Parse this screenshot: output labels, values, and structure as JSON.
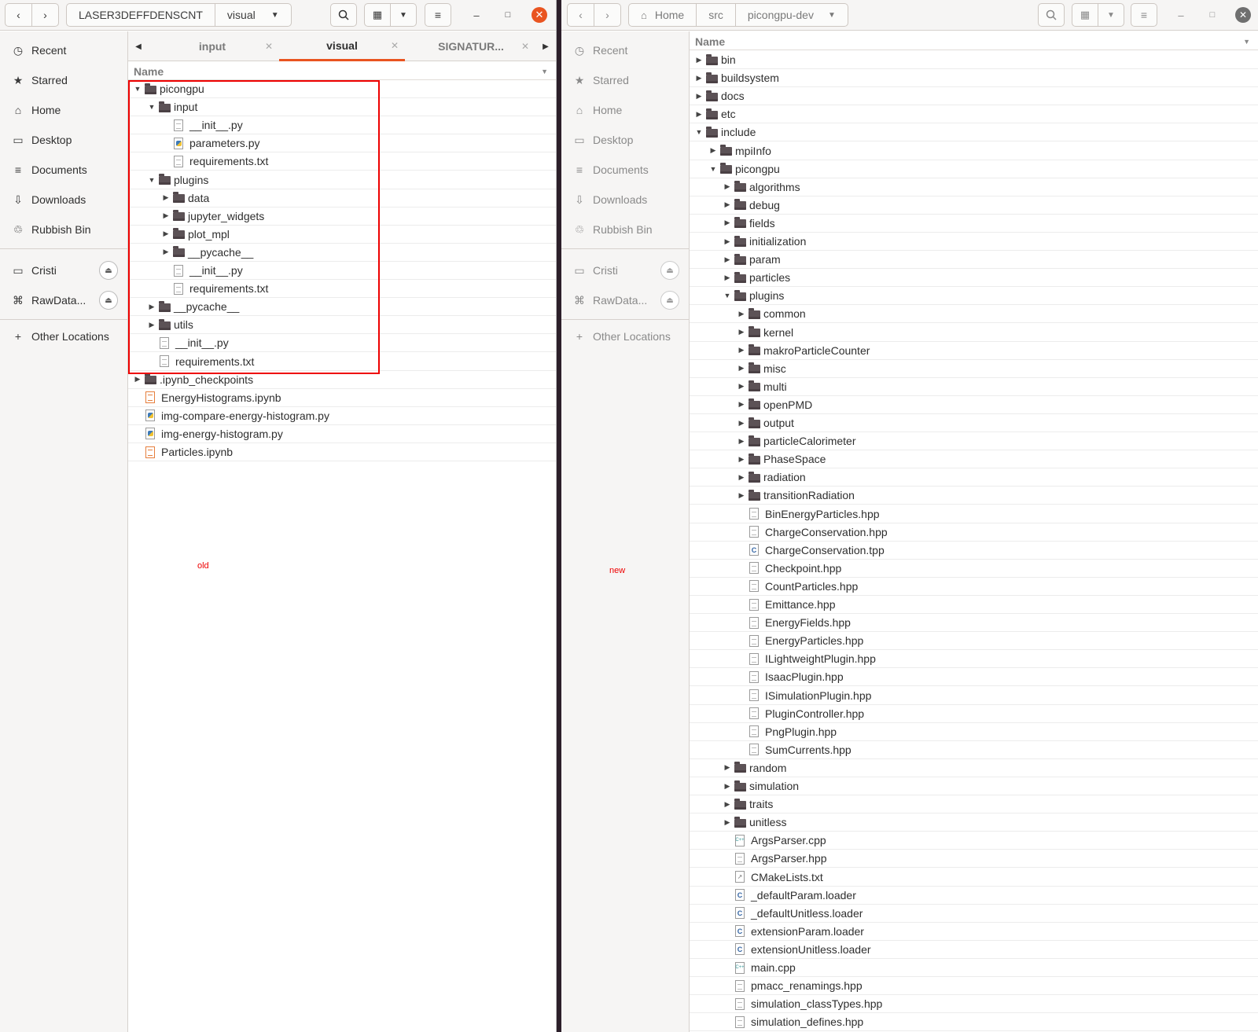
{
  "left_window": {
    "path": [
      "LASER3DEFFDENSCNT",
      "visual"
    ],
    "tabs": [
      {
        "label": "input"
      },
      {
        "label": "visual"
      },
      {
        "label": "SIGNATUR..."
      }
    ],
    "column_header": "Name",
    "annotation": "old",
    "rows": [
      {
        "name": "picongpu",
        "kind": "folder",
        "depth": 0,
        "expanded": true
      },
      {
        "name": "input",
        "kind": "folder",
        "depth": 1,
        "expanded": true
      },
      {
        "name": "__init__.py",
        "kind": "file",
        "depth": 2
      },
      {
        "name": "parameters.py",
        "kind": "py",
        "depth": 2
      },
      {
        "name": "requirements.txt",
        "kind": "file",
        "depth": 2
      },
      {
        "name": "plugins",
        "kind": "folder",
        "depth": 1,
        "expanded": true
      },
      {
        "name": "data",
        "kind": "folder",
        "depth": 2,
        "expanded": false
      },
      {
        "name": "jupyter_widgets",
        "kind": "folder",
        "depth": 2,
        "expanded": false
      },
      {
        "name": "plot_mpl",
        "kind": "folder",
        "depth": 2,
        "expanded": false
      },
      {
        "name": "__pycache__",
        "kind": "folder",
        "depth": 2,
        "expanded": false
      },
      {
        "name": "__init__.py",
        "kind": "file",
        "depth": 2
      },
      {
        "name": "requirements.txt",
        "kind": "file",
        "depth": 2
      },
      {
        "name": "__pycache__",
        "kind": "folder",
        "depth": 1,
        "expanded": false
      },
      {
        "name": "utils",
        "kind": "folder",
        "depth": 1,
        "expanded": false
      },
      {
        "name": "__init__.py",
        "kind": "file",
        "depth": 1
      },
      {
        "name": "requirements.txt",
        "kind": "file",
        "depth": 1
      },
      {
        "name": ".ipynb_checkpoints",
        "kind": "folder",
        "depth": 0,
        "expanded": false
      },
      {
        "name": "EnergyHistograms.ipynb",
        "kind": "nb",
        "depth": 0
      },
      {
        "name": "img-compare-energy-histogram.py",
        "kind": "py",
        "depth": 0
      },
      {
        "name": "img-energy-histogram.py",
        "kind": "py",
        "depth": 0
      },
      {
        "name": "Particles.ipynb",
        "kind": "nb",
        "depth": 0
      }
    ]
  },
  "right_window": {
    "path": [
      "Home",
      "src",
      "picongpu-dev"
    ],
    "column_header": "Name",
    "annotation": "new",
    "rows": [
      {
        "name": "bin",
        "kind": "folder",
        "depth": 0,
        "expanded": false
      },
      {
        "name": "buildsystem",
        "kind": "folder",
        "depth": 0,
        "expanded": false
      },
      {
        "name": "docs",
        "kind": "folder",
        "depth": 0,
        "expanded": false
      },
      {
        "name": "etc",
        "kind": "folder",
        "depth": 0,
        "expanded": false
      },
      {
        "name": "include",
        "kind": "folder",
        "depth": 0,
        "expanded": true
      },
      {
        "name": "mpiInfo",
        "kind": "folder",
        "depth": 1,
        "expanded": false
      },
      {
        "name": "picongpu",
        "kind": "folder",
        "depth": 1,
        "expanded": true
      },
      {
        "name": "algorithms",
        "kind": "folder",
        "depth": 2,
        "expanded": false
      },
      {
        "name": "debug",
        "kind": "folder",
        "depth": 2,
        "expanded": false
      },
      {
        "name": "fields",
        "kind": "folder",
        "depth": 2,
        "expanded": false
      },
      {
        "name": "initialization",
        "kind": "folder",
        "depth": 2,
        "expanded": false
      },
      {
        "name": "param",
        "kind": "folder",
        "depth": 2,
        "expanded": false
      },
      {
        "name": "particles",
        "kind": "folder",
        "depth": 2,
        "expanded": false
      },
      {
        "name": "plugins",
        "kind": "folder",
        "depth": 2,
        "expanded": true
      },
      {
        "name": "common",
        "kind": "folder",
        "depth": 3,
        "expanded": false
      },
      {
        "name": "kernel",
        "kind": "folder",
        "depth": 3,
        "expanded": false
      },
      {
        "name": "makroParticleCounter",
        "kind": "folder",
        "depth": 3,
        "expanded": false
      },
      {
        "name": "misc",
        "kind": "folder",
        "depth": 3,
        "expanded": false
      },
      {
        "name": "multi",
        "kind": "folder",
        "depth": 3,
        "expanded": false
      },
      {
        "name": "openPMD",
        "kind": "folder",
        "depth": 3,
        "expanded": false
      },
      {
        "name": "output",
        "kind": "folder",
        "depth": 3,
        "expanded": false
      },
      {
        "name": "particleCalorimeter",
        "kind": "folder",
        "depth": 3,
        "expanded": false
      },
      {
        "name": "PhaseSpace",
        "kind": "folder",
        "depth": 3,
        "expanded": false
      },
      {
        "name": "radiation",
        "kind": "folder",
        "depth": 3,
        "expanded": false
      },
      {
        "name": "transitionRadiation",
        "kind": "folder",
        "depth": 3,
        "expanded": false
      },
      {
        "name": "BinEnergyParticles.hpp",
        "kind": "file",
        "depth": 3
      },
      {
        "name": "ChargeConservation.hpp",
        "kind": "file",
        "depth": 3
      },
      {
        "name": "ChargeConservation.tpp",
        "kind": "c",
        "depth": 3
      },
      {
        "name": "Checkpoint.hpp",
        "kind": "file",
        "depth": 3
      },
      {
        "name": "CountParticles.hpp",
        "kind": "file",
        "depth": 3
      },
      {
        "name": "Emittance.hpp",
        "kind": "file",
        "depth": 3
      },
      {
        "name": "EnergyFields.hpp",
        "kind": "file",
        "depth": 3
      },
      {
        "name": "EnergyParticles.hpp",
        "kind": "file",
        "depth": 3
      },
      {
        "name": "ILightweightPlugin.hpp",
        "kind": "file",
        "depth": 3
      },
      {
        "name": "IsaacPlugin.hpp",
        "kind": "file",
        "depth": 3
      },
      {
        "name": "ISimulationPlugin.hpp",
        "kind": "file",
        "depth": 3
      },
      {
        "name": "PluginController.hpp",
        "kind": "file",
        "depth": 3
      },
      {
        "name": "PngPlugin.hpp",
        "kind": "file",
        "depth": 3
      },
      {
        "name": "SumCurrents.hpp",
        "kind": "file",
        "depth": 3
      },
      {
        "name": "random",
        "kind": "folder",
        "depth": 2,
        "expanded": false
      },
      {
        "name": "simulation",
        "kind": "folder",
        "depth": 2,
        "expanded": false
      },
      {
        "name": "traits",
        "kind": "folder",
        "depth": 2,
        "expanded": false
      },
      {
        "name": "unitless",
        "kind": "folder",
        "depth": 2,
        "expanded": false
      },
      {
        "name": "ArgsParser.cpp",
        "kind": "cpp",
        "depth": 2
      },
      {
        "name": "ArgsParser.hpp",
        "kind": "file",
        "depth": 2
      },
      {
        "name": "CMakeLists.txt",
        "kind": "link",
        "depth": 2
      },
      {
        "name": "_defaultParam.loader",
        "kind": "c",
        "depth": 2
      },
      {
        "name": "_defaultUnitless.loader",
        "kind": "c",
        "depth": 2
      },
      {
        "name": "extensionParam.loader",
        "kind": "c",
        "depth": 2
      },
      {
        "name": "extensionUnitless.loader",
        "kind": "c",
        "depth": 2
      },
      {
        "name": "main.cpp",
        "kind": "cpp",
        "depth": 2
      },
      {
        "name": "pmacc_renamings.hpp",
        "kind": "file",
        "depth": 2
      },
      {
        "name": "simulation_classTypes.hpp",
        "kind": "file",
        "depth": 2
      },
      {
        "name": "simulation_defines.hpp",
        "kind": "file",
        "depth": 2
      }
    ]
  },
  "sidebar": {
    "places": [
      {
        "label": "Recent",
        "icon": "clock-icon"
      },
      {
        "label": "Starred",
        "icon": "star-icon"
      },
      {
        "label": "Home",
        "icon": "home-icon"
      },
      {
        "label": "Desktop",
        "icon": "desktop-icon"
      },
      {
        "label": "Documents",
        "icon": "documents-icon"
      },
      {
        "label": "Downloads",
        "icon": "download-icon"
      },
      {
        "label": "Rubbish Bin",
        "icon": "trash-icon"
      }
    ],
    "devices": [
      {
        "label": "Cristi",
        "icon": "drive-icon"
      },
      {
        "label": "RawData...",
        "icon": "usb-icon"
      }
    ],
    "other": "Other Locations"
  },
  "colors": {
    "accent": "#e95420",
    "highlight": "#ee0000"
  }
}
